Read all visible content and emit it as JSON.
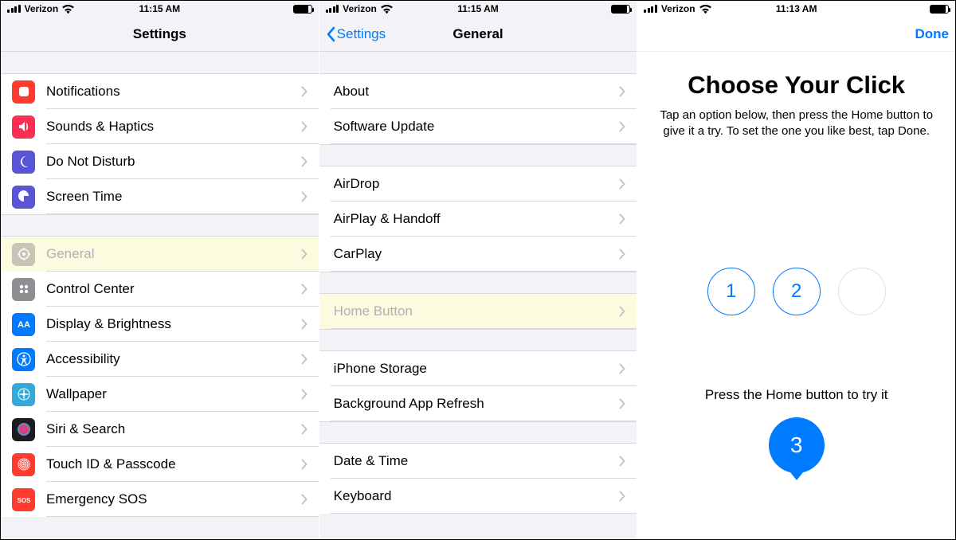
{
  "statusbars": {
    "pane1": {
      "carrier": "Verizon",
      "time": "11:15 AM"
    },
    "pane2": {
      "carrier": "Verizon",
      "time": "11:15 AM"
    },
    "pane3": {
      "carrier": "Verizon",
      "time": "11:13 AM"
    }
  },
  "pane1": {
    "title": "Settings",
    "rowsA": [
      {
        "label": "Notifications",
        "icon": "notifications",
        "bg": "#ff3b30"
      },
      {
        "label": "Sounds & Haptics",
        "icon": "sounds",
        "bg": "#ff2d55"
      },
      {
        "label": "Do Not Disturb",
        "icon": "dnd",
        "bg": "#5856d6"
      },
      {
        "label": "Screen Time",
        "icon": "screentime",
        "bg": "#5856d6"
      }
    ],
    "rowsB": [
      {
        "label": "General",
        "icon": "general",
        "bg": "#8e8e93",
        "highlight": true
      },
      {
        "label": "Control Center",
        "icon": "controlcenter",
        "bg": "#8e8e93"
      },
      {
        "label": "Display & Brightness",
        "icon": "display",
        "bg": "#007aff"
      },
      {
        "label": "Accessibility",
        "icon": "accessibility",
        "bg": "#007aff"
      },
      {
        "label": "Wallpaper",
        "icon": "wallpaper",
        "bg": "#34aadc"
      },
      {
        "label": "Siri & Search",
        "icon": "siri",
        "bg": "#1c1c1e"
      },
      {
        "label": "Touch ID & Passcode",
        "icon": "touchid",
        "bg": "#ff3b30"
      },
      {
        "label": "Emergency SOS",
        "icon": "sos",
        "bg": "#ff3b30"
      }
    ]
  },
  "pane2": {
    "back": "Settings",
    "title": "General",
    "groups": [
      [
        {
          "label": "About"
        },
        {
          "label": "Software Update"
        }
      ],
      [
        {
          "label": "AirDrop"
        },
        {
          "label": "AirPlay & Handoff"
        },
        {
          "label": "CarPlay"
        }
      ],
      [
        {
          "label": "Home Button",
          "highlight": true
        }
      ],
      [
        {
          "label": "iPhone Storage"
        },
        {
          "label": "Background App Refresh"
        }
      ],
      [
        {
          "label": "Date & Time"
        },
        {
          "label": "Keyboard"
        }
      ]
    ]
  },
  "pane3": {
    "done": "Done",
    "hero": "Choose Your Click",
    "desc": "Tap an option below, then press the Home button to give it a try. To set the one you like best, tap Done.",
    "opt1": "1",
    "opt2": "2",
    "tryit": "Press the Home button to try it",
    "big": "3"
  }
}
